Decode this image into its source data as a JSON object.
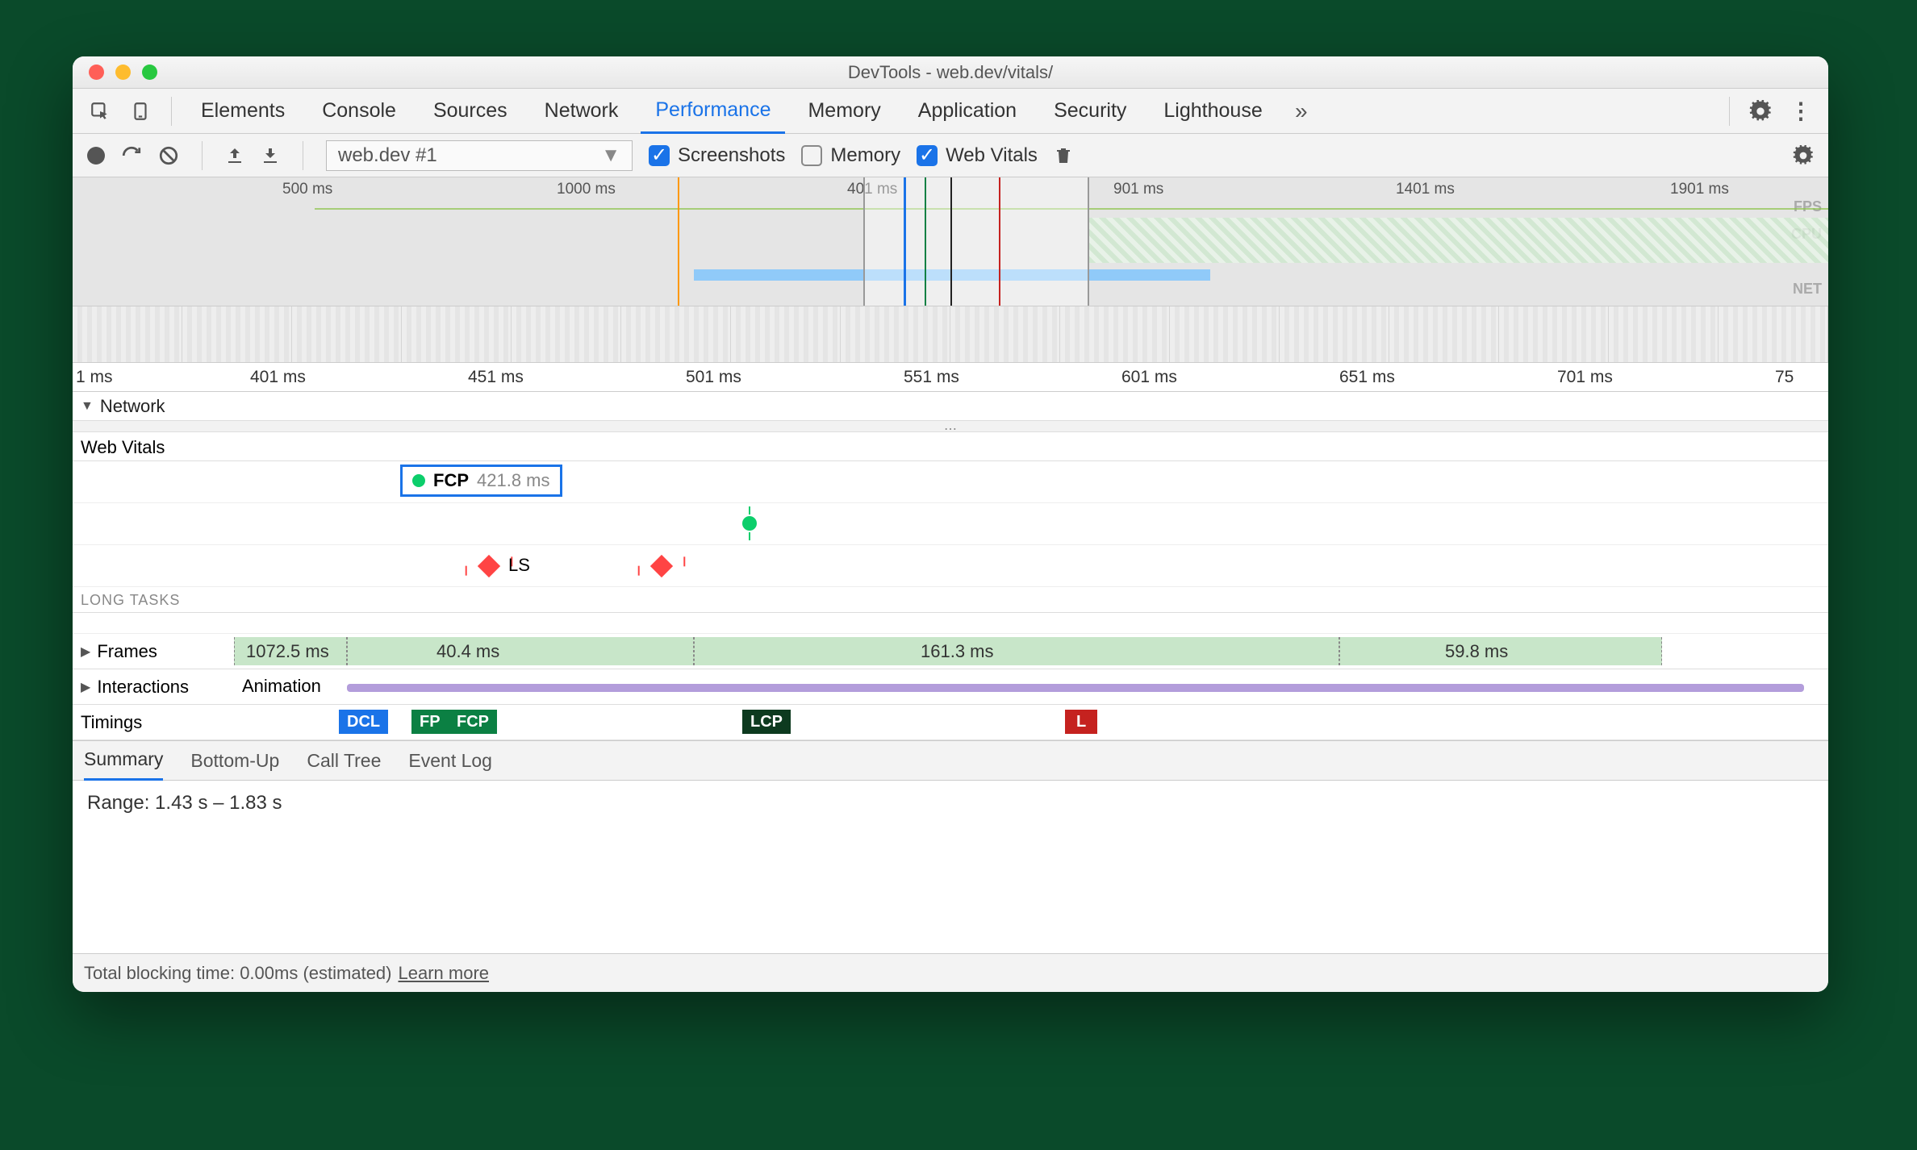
{
  "window_title": "DevTools - web.dev/vitals/",
  "tabs": [
    "Elements",
    "Console",
    "Sources",
    "Network",
    "Performance",
    "Memory",
    "Application",
    "Security",
    "Lighthouse"
  ],
  "active_tab": "Performance",
  "toolbar": {
    "profile_select": "web.dev #1",
    "screenshots": {
      "label": "Screenshots",
      "checked": true
    },
    "memory": {
      "label": "Memory",
      "checked": false
    },
    "web_vitals": {
      "label": "Web Vitals",
      "checked": true
    }
  },
  "overview": {
    "ticks": [
      "500 ms",
      "1000 ms",
      "401 ms",
      "901 ms",
      "1401 ms",
      "1901 ms"
    ],
    "side_labels": [
      "FPS",
      "CPU",
      "NET"
    ]
  },
  "ruler_ticks": [
    "1 ms",
    "401 ms",
    "451 ms",
    "501 ms",
    "551 ms",
    "601 ms",
    "651 ms",
    "701 ms",
    "75"
  ],
  "network_label": "Network",
  "web_vitals": {
    "header": "Web Vitals",
    "fcp_label": "FCP",
    "fcp_value": "421.8 ms",
    "ls_label": "LS",
    "long_tasks_label": "LONG TASKS"
  },
  "frames": {
    "label": "Frames",
    "segments": [
      "1072.5 ms",
      "40.4 ms",
      "161.3 ms",
      "59.8 ms"
    ]
  },
  "interactions": {
    "label": "Interactions",
    "animation": "Animation"
  },
  "timings": {
    "label": "Timings",
    "markers": [
      {
        "name": "DCL",
        "color": "#1a73e8"
      },
      {
        "name": "FP",
        "color": "#0b8043"
      },
      {
        "name": "FCP",
        "color": "#0b8043"
      },
      {
        "name": "LCP",
        "color": "#0d3a1f"
      },
      {
        "name": "L",
        "color": "#c5221f"
      }
    ]
  },
  "bottom_tabs": [
    "Summary",
    "Bottom-Up",
    "Call Tree",
    "Event Log"
  ],
  "summary_range": "Range: 1.43 s – 1.83 s",
  "footer": {
    "tbt": "Total blocking time: 0.00ms (estimated)",
    "learn": "Learn more"
  }
}
